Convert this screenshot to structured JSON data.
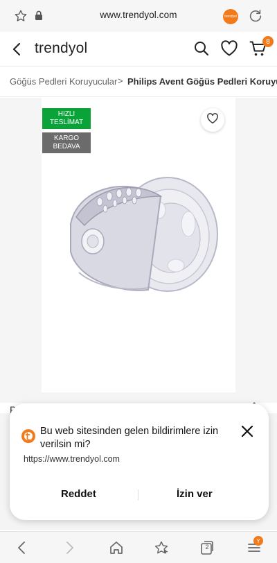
{
  "browser": {
    "url": "www.trendyol.com",
    "site_badge": "trendyol",
    "tab_count": "2",
    "menu_badge": "Y"
  },
  "header": {
    "logo": "trendyol",
    "cart_count": "8"
  },
  "breadcrumb": {
    "parent": "Göğüs Pedleri Koruyucular",
    "separator": ">",
    "current": "Philips Avent Göğüs Pedleri Koruyucu"
  },
  "product": {
    "badges": {
      "fast_line1": "HIZLI",
      "fast_line2": "TESLİMAT",
      "cargo_line1": "KARGO",
      "cargo_line2": "BEDAVA"
    },
    "title_peek": "P",
    "share_peek": "⇡"
  },
  "permission_dialog": {
    "message": "Bu web sitesinden gelen bildirimlere izin verilsin mi?",
    "origin": "https://www.trendyol.com",
    "deny_label": "Reddet",
    "allow_label": "İzin ver"
  },
  "colors": {
    "brand_orange": "#f27a1a",
    "fast_green": "#0aa33a",
    "cargo_gray": "#6b6b6b"
  }
}
